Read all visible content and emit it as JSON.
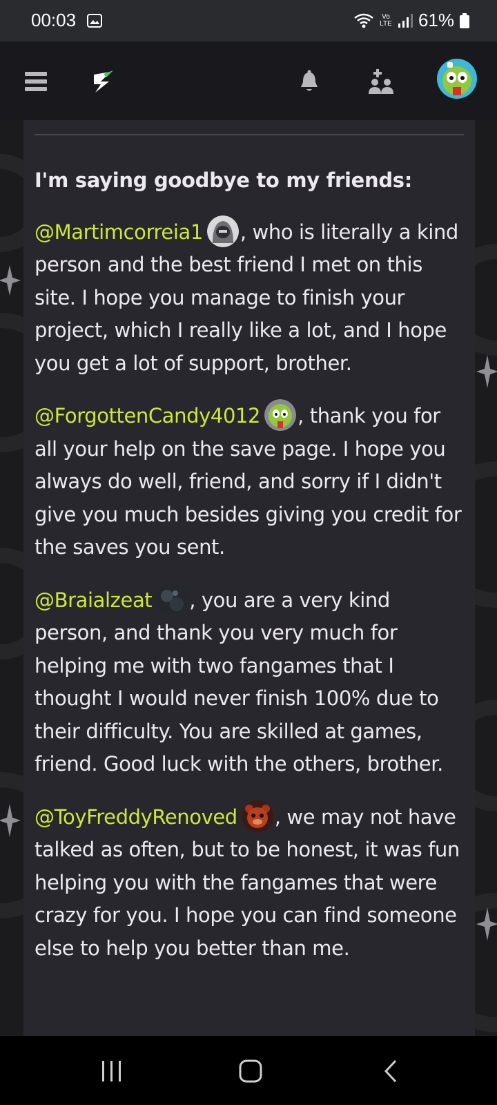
{
  "status_bar": {
    "time": "00:03",
    "network_label": "Vo LTE",
    "battery": "61%",
    "icons": [
      "image-icon",
      "wifi-icon",
      "signal-icon",
      "battery-icon"
    ]
  },
  "app_header": {
    "icons": [
      "menu-icon",
      "site-logo-icon",
      "notifications-bell-icon",
      "friend-requests-icon",
      "profile-avatar"
    ]
  },
  "post": {
    "heading": "I'm saying goodbye to my friends:",
    "paragraphs": [
      {
        "mention": "@Martimcorreia1",
        "avatar": "hooded-figure-avatar",
        "text": ", who is literally a kind person and the best friend I met on this site. I hope you manage to finish your project, which I really like a lot, and I hope you get a lot of support, brother."
      },
      {
        "mention": "@ForgottenCandy4012",
        "avatar": "green-animatronic-avatar",
        "text": ", thank you for all your help on the save page. I hope you always do well, friend, and sorry if I didn't give you much besides giving you credit for the saves you sent."
      },
      {
        "mention": "@Braialzeat",
        "avatar": "dark-scene-avatar",
        "text": ", you are a very kind person, and thank you very much for helping me with two fangames that I thought I would never finish 100% due to their difficulty. You are skilled at games, friend. Good luck with the others, brother."
      },
      {
        "mention": "@ToyFreddyRenoved",
        "avatar": "freddy-bear-avatar",
        "text": ", we may not have talked as often, but to be honest, it was fun helping you with the fangames that were crazy for you. I hope you can find someone else to help you better than me."
      }
    ]
  },
  "colors": {
    "mention": "#cde83a",
    "card_background": "#28272d",
    "header_background": "#19191d"
  },
  "nav_bar": {
    "icons": [
      "recent-apps-icon",
      "home-icon",
      "back-icon"
    ]
  }
}
